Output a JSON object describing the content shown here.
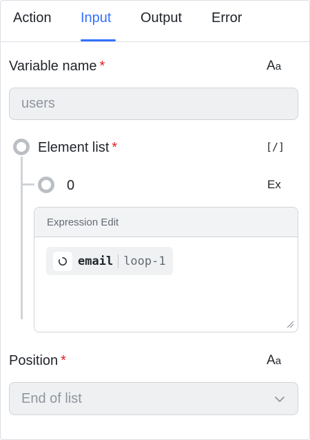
{
  "tabs": [
    {
      "label": "Action",
      "active": false
    },
    {
      "label": "Input",
      "active": true
    },
    {
      "label": "Output",
      "active": false
    },
    {
      "label": "Error",
      "active": false
    }
  ],
  "accent_color": "#3370ff",
  "required_color": "#e02020",
  "variable_name": {
    "label": "Variable name",
    "required_mark": "*",
    "type_icon_main": "A",
    "type_icon_sub": "a",
    "value": "users"
  },
  "element_list": {
    "label": "Element list",
    "required_mark": "*",
    "type_icon": "[/]",
    "items": [
      {
        "index": "0",
        "type_icon": "Ex"
      }
    ]
  },
  "expression_editor": {
    "header": "Expression Edit",
    "chip": {
      "icon": "loop-icon",
      "name": "email",
      "source": "loop-1"
    }
  },
  "position": {
    "label": "Position",
    "required_mark": "*",
    "type_icon_main": "A",
    "type_icon_sub": "a",
    "value": "End of list",
    "dropdown_icon": "chevron-down-icon"
  }
}
